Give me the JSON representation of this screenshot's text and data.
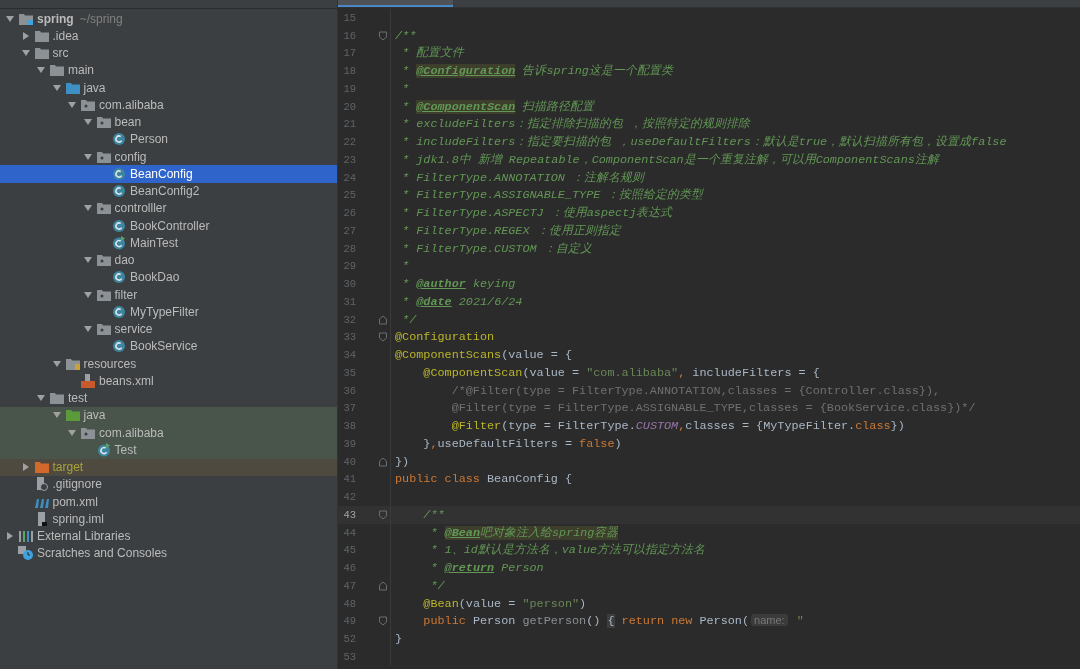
{
  "project_tree": [
    {
      "label": "spring",
      "hint": "~/spring",
      "kind": "project",
      "expanded": true,
      "selected": false,
      "children": [
        {
          "label": ".idea",
          "kind": "folder",
          "expanded": false,
          "selected": false
        },
        {
          "label": "src",
          "kind": "folder",
          "expanded": true,
          "selected": false,
          "children": [
            {
              "label": "main",
              "kind": "folder",
              "expanded": true,
              "selected": false,
              "children": [
                {
                  "label": "java",
                  "kind": "source-folder",
                  "expanded": true,
                  "selected": false,
                  "children": [
                    {
                      "label": "com.alibaba",
                      "kind": "package",
                      "expanded": true,
                      "selected": false,
                      "children": [
                        {
                          "label": "bean",
                          "kind": "package",
                          "expanded": true,
                          "selected": false,
                          "children": [
                            {
                              "label": "Person",
                              "kind": "class",
                              "selected": false
                            }
                          ]
                        },
                        {
                          "label": "config",
                          "kind": "package",
                          "expanded": true,
                          "selected": false,
                          "children": [
                            {
                              "label": "BeanConfig",
                              "kind": "class",
                              "selected": true
                            },
                            {
                              "label": "BeanConfig2",
                              "kind": "class",
                              "selected": false
                            }
                          ]
                        },
                        {
                          "label": "controlller",
                          "kind": "package",
                          "expanded": true,
                          "selected": false,
                          "children": [
                            {
                              "label": "BookController",
                              "kind": "class",
                              "selected": false
                            },
                            {
                              "label": "MainTest",
                              "kind": "runnable-class",
                              "selected": false
                            }
                          ]
                        },
                        {
                          "label": "dao",
                          "kind": "package",
                          "expanded": true,
                          "selected": false,
                          "children": [
                            {
                              "label": "BookDao",
                              "kind": "class",
                              "selected": false
                            }
                          ]
                        },
                        {
                          "label": "filter",
                          "kind": "package",
                          "expanded": true,
                          "selected": false,
                          "children": [
                            {
                              "label": "MyTypeFilter",
                              "kind": "class",
                              "selected": false
                            }
                          ]
                        },
                        {
                          "label": "service",
                          "kind": "package",
                          "expanded": true,
                          "selected": false,
                          "children": [
                            {
                              "label": "BookService",
                              "kind": "class",
                              "selected": false
                            }
                          ]
                        }
                      ]
                    }
                  ]
                },
                {
                  "label": "resources",
                  "kind": "resources-folder",
                  "expanded": true,
                  "selected": false,
                  "children": [
                    {
                      "label": "beans.xml",
                      "kind": "xml",
                      "selected": false
                    }
                  ]
                }
              ]
            },
            {
              "label": "test",
              "kind": "folder",
              "expanded": true,
              "selected": false,
              "children": [
                {
                  "label": "java",
                  "kind": "test-folder",
                  "expanded": true,
                  "selected": false,
                  "children": [
                    {
                      "label": "com.alibaba",
                      "kind": "package",
                      "expanded": true,
                      "selected": false,
                      "children": [
                        {
                          "label": "Test",
                          "kind": "runnable-class",
                          "selected": false
                        }
                      ]
                    }
                  ]
                }
              ]
            }
          ]
        },
        {
          "label": "target",
          "kind": "excluded-folder",
          "expanded": false,
          "selected": false
        },
        {
          "label": ".gitignore",
          "kind": "ignore-file",
          "selected": false
        },
        {
          "label": "pom.xml",
          "kind": "maven-file",
          "selected": false
        },
        {
          "label": "spring.iml",
          "kind": "module-file",
          "selected": false
        }
      ]
    },
    {
      "label": "External Libraries",
      "kind": "libraries",
      "expanded": false,
      "selected": false
    },
    {
      "label": "Scratches and Consoles",
      "kind": "scratches",
      "selected": false
    }
  ],
  "editor": {
    "lines": [
      {
        "n": "15",
        "kind": "plain"
      },
      {
        "n": "16",
        "kind": "fold-start",
        "t": [
          {
            "text": "/**",
            "kind": "doc"
          }
        ]
      },
      {
        "n": "17",
        "kind": "plain",
        "t": [
          {
            "text": " * 配置文件",
            "kind": "doc"
          }
        ]
      },
      {
        "n": "18",
        "kind": "plain",
        "t": [
          {
            "text": " * ",
            "kind": "doc"
          },
          {
            "text": "@Configuration",
            "kind": "tagmark"
          },
          {
            "text": " 告诉spring这是一个配置类",
            "kind": "doc"
          }
        ]
      },
      {
        "n": "19",
        "kind": "plain",
        "t": [
          {
            "text": " *",
            "kind": "doc"
          }
        ]
      },
      {
        "n": "20",
        "kind": "plain",
        "t": [
          {
            "text": " * ",
            "kind": "doc"
          },
          {
            "text": "@ComponentScan",
            "kind": "tagmark"
          },
          {
            "text": " 扫描路径配置",
            "kind": "doc"
          }
        ]
      },
      {
        "n": "21",
        "kind": "plain",
        "t": [
          {
            "text": " * excludeFilters：指定排除扫描的包 ，按照特定的规则排除",
            "kind": "doc"
          }
        ]
      },
      {
        "n": "22",
        "kind": "plain",
        "t": [
          {
            "text": " * includeFilters：指定要扫描的包 ，useDefaultFilters：默认是true，默认扫描所有包，设置成false",
            "kind": "doc"
          }
        ]
      },
      {
        "n": "23",
        "kind": "plain",
        "t": [
          {
            "text": " * jdk1.8中 新增 Repeatable，ComponentScan是一个重复注解，可以用ComponentScans注解",
            "kind": "doc"
          }
        ]
      },
      {
        "n": "24",
        "kind": "plain",
        "t": [
          {
            "text": " * FilterType.ANNOTATION ：注解名规则",
            "kind": "doc"
          }
        ]
      },
      {
        "n": "25",
        "kind": "plain",
        "t": [
          {
            "text": " * FilterType.ASSIGNABLE_TYPE ：按照给定的类型",
            "kind": "doc"
          }
        ]
      },
      {
        "n": "26",
        "kind": "plain",
        "t": [
          {
            "text": " * FilterType.ASPECTJ ：使用aspectj表达式",
            "kind": "doc"
          }
        ]
      },
      {
        "n": "27",
        "kind": "plain",
        "t": [
          {
            "text": " * FilterType.REGEX ：使用正则指定",
            "kind": "doc"
          }
        ]
      },
      {
        "n": "28",
        "kind": "plain",
        "t": [
          {
            "text": " * FilterType.CUSTOM ：自定义",
            "kind": "doc"
          }
        ]
      },
      {
        "n": "29",
        "kind": "plain",
        "t": [
          {
            "text": " *",
            "kind": "doc"
          }
        ]
      },
      {
        "n": "30",
        "kind": "plain",
        "t": [
          {
            "text": " * ",
            "kind": "doc"
          },
          {
            "text": "@author",
            "kind": "tag"
          },
          {
            "text": " keying",
            "kind": "doc"
          }
        ]
      },
      {
        "n": "31",
        "kind": "plain",
        "t": [
          {
            "text": " * ",
            "kind": "doc"
          },
          {
            "text": "@date",
            "kind": "tag"
          },
          {
            "text": " 2021/6/24",
            "kind": "doc"
          }
        ]
      },
      {
        "n": "32",
        "kind": "fold-end",
        "t": [
          {
            "text": " */",
            "kind": "doc"
          }
        ]
      },
      {
        "n": "33",
        "kind": "fold-start",
        "t": [
          {
            "text": "@Configuration",
            "kind": "annotation"
          }
        ]
      },
      {
        "n": "34",
        "kind": "plain",
        "t": [
          {
            "text": "@ComponentScans",
            "kind": "annotation"
          },
          {
            "text": "(value = {",
            "kind": "plain"
          }
        ]
      },
      {
        "n": "35",
        "kind": "plain",
        "t": [
          {
            "text": "    @ComponentScan",
            "kind": "annotation"
          },
          {
            "text": "(value = ",
            "kind": "plain"
          },
          {
            "text": "\"com.alibaba\"",
            "kind": "string"
          },
          {
            "text": ",",
            "kind": "keyword"
          },
          {
            "text": " includeFilters = {",
            "kind": "plain"
          }
        ]
      },
      {
        "n": "36",
        "kind": "plain",
        "t": [
          {
            "text": "        /*@Filter(type = FilterType.ANNOTATION,classes = {Controller.class}),",
            "kind": "comment"
          }
        ]
      },
      {
        "n": "37",
        "kind": "plain",
        "t": [
          {
            "text": "        @Filter(type = FilterType.ASSIGNABLE_TYPE,classes = {BookService.class})*/",
            "kind": "comment"
          }
        ]
      },
      {
        "n": "38",
        "kind": "plain",
        "t": [
          {
            "text": "        @Filter",
            "kind": "annotation"
          },
          {
            "text": "(type = FilterType.",
            "kind": "plain"
          },
          {
            "text": "CUSTOM",
            "kind": "constant"
          },
          {
            "text": ",",
            "kind": "keyword"
          },
          {
            "text": "classes = {MyTypeFilter.",
            "kind": "plain"
          },
          {
            "text": "class",
            "kind": "keyword"
          },
          {
            "text": "})",
            "kind": "plain"
          }
        ]
      },
      {
        "n": "39",
        "kind": "plain",
        "t": [
          {
            "text": "    }",
            "kind": "plain"
          },
          {
            "text": ",",
            "kind": "keyword"
          },
          {
            "text": "useDefaultFilters = ",
            "kind": "plain"
          },
          {
            "text": "false",
            "kind": "keyword"
          },
          {
            "text": ")",
            "kind": "plain"
          }
        ]
      },
      {
        "n": "40",
        "kind": "fold-end",
        "t": [
          {
            "text": "})",
            "kind": "plain"
          }
        ]
      },
      {
        "n": "41",
        "kind": "plain",
        "t": [
          {
            "text": "public class",
            "kind": "keyword"
          },
          {
            "text": " BeanConfig {",
            "kind": "plain"
          }
        ]
      },
      {
        "n": "42",
        "kind": "plain"
      },
      {
        "n": "43",
        "kind": "fold-start",
        "current": true,
        "t": [
          {
            "text": "    /**",
            "kind": "doc"
          }
        ]
      },
      {
        "n": "44",
        "kind": "plain",
        "t": [
          {
            "text": "     * ",
            "kind": "doc"
          },
          {
            "text": "@Bean",
            "kind": "tagmark"
          },
          {
            "text": "吧对象注入给spring容器",
            "kind": "mark"
          }
        ]
      },
      {
        "n": "45",
        "kind": "plain",
        "t": [
          {
            "text": "     * 1、id默认是方法名，value方法可以指定方法名",
            "kind": "doc"
          }
        ]
      },
      {
        "n": "46",
        "kind": "plain",
        "t": [
          {
            "text": "     * ",
            "kind": "doc"
          },
          {
            "text": "@return",
            "kind": "tag"
          },
          {
            "text": " Person",
            "kind": "doc"
          }
        ]
      },
      {
        "n": "47",
        "kind": "fold-end",
        "t": [
          {
            "text": "     */",
            "kind": "doc"
          }
        ]
      },
      {
        "n": "48",
        "kind": "plain",
        "t": [
          {
            "text": "    @Bean",
            "kind": "annotation"
          },
          {
            "text": "(value = ",
            "kind": "plain"
          },
          {
            "text": "\"person\"",
            "kind": "string"
          },
          {
            "text": ")",
            "kind": "plain"
          }
        ]
      },
      {
        "n": "49",
        "kind": "fold-start",
        "t": [
          {
            "text": "    public",
            "kind": "keyword"
          },
          {
            "text": " Person ",
            "kind": "plain"
          },
          {
            "text": "getPerson",
            "kind": "method"
          },
          {
            "text": "() ",
            "kind": "plain"
          },
          {
            "text": "{",
            "kind": "folded"
          },
          {
            "text": " return new",
            "kind": "keyword"
          },
          {
            "text": " Person(",
            "kind": "plain"
          },
          {
            "text": "name:",
            "kind": "hint"
          },
          {
            "text": " \"",
            "kind": "string"
          }
        ]
      },
      {
        "n": "52",
        "kind": "plain",
        "t": [
          {
            "text": "}",
            "kind": "plain"
          }
        ]
      },
      {
        "n": "53",
        "kind": "plain"
      }
    ]
  }
}
